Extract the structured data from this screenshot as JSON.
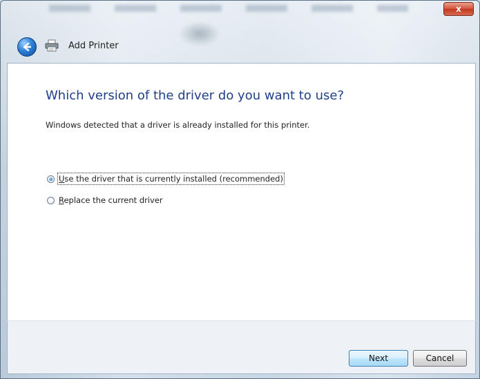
{
  "window": {
    "title": "Add Printer",
    "close_symbol": "x"
  },
  "icons": {
    "back": "back-arrow-icon",
    "printer": "printer-icon",
    "close": "close-icon"
  },
  "content": {
    "heading": "Which version of the driver do you want to use?",
    "description": "Windows detected that a driver is already installed for this printer.",
    "options": [
      {
        "label": "Use the driver that is currently installed (recommended)",
        "mnemonic": "U",
        "rest": "se the driver that is currently installed (recommended)",
        "selected": true
      },
      {
        "label": "Replace the current driver",
        "mnemonic": "R",
        "rest": "eplace the current driver",
        "selected": false
      }
    ]
  },
  "footer": {
    "next_label": "Next",
    "cancel_label": "Cancel"
  },
  "colors": {
    "heading": "#1f3f8a",
    "close_button": "#c0391f",
    "default_button_border": "#3c7fb1"
  }
}
